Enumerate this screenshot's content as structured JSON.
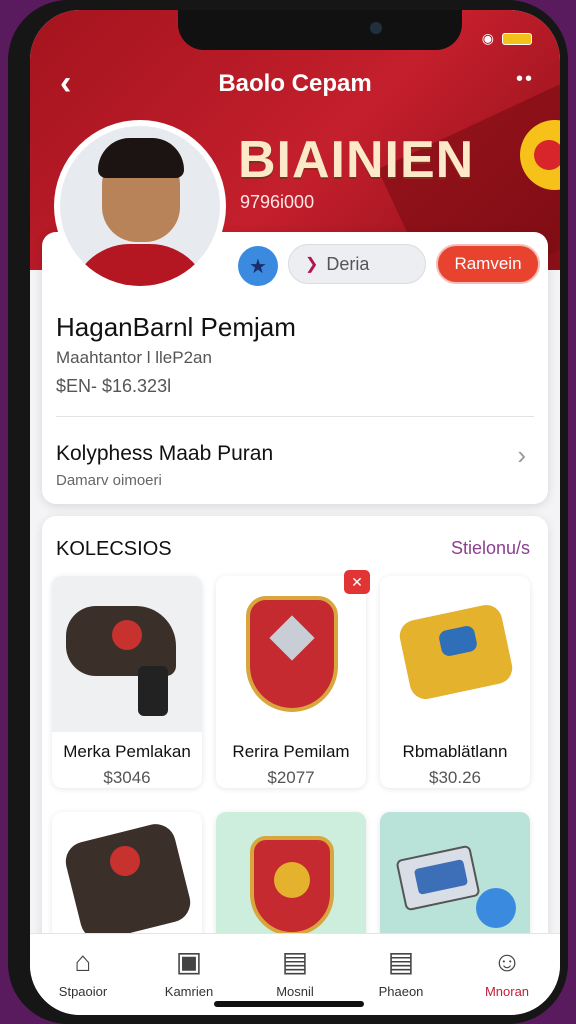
{
  "header": {
    "title": "Baolo Cepam",
    "back_icon": "chevron-left-icon",
    "more_icon": "more-dots-icon",
    "banner_text": "BIAINIEN",
    "banner_number": "9796i000"
  },
  "profile": {
    "name": "HaganBarnl Pemjam",
    "subtitle": "Maahtantor l lleP2an",
    "price_range": "$EN- $16.323l",
    "star_icon": "star-icon",
    "secondary_button": "Deria",
    "primary_button": "Ramvein",
    "row_title": "Kolyphess Maab Puran",
    "row_subtitle": "Damarv oimoeri"
  },
  "collection": {
    "title": "KOLECSIOS",
    "link": "Stielonu/s",
    "items": [
      {
        "name": "Merka Pemlakan",
        "price": "$3046"
      },
      {
        "name": "Rerira Pemilam",
        "price": "$2077"
      },
      {
        "name": "Rbmablätlann",
        "price": "$30.26"
      }
    ]
  },
  "tabs": [
    {
      "label": "Stpaoior",
      "icon": "home-icon"
    },
    {
      "label": "Kamrien",
      "icon": "box-icon"
    },
    {
      "label": "Mosnil",
      "icon": "wallet-icon"
    },
    {
      "label": "Phaeon",
      "icon": "document-icon"
    },
    {
      "label": "Mnoran",
      "icon": "profile-icon"
    }
  ],
  "colors": {
    "hero": "#c41f2c",
    "accent_red": "#e8432f",
    "link_purple": "#8b3f8f",
    "active_tab": "#c0203a"
  }
}
